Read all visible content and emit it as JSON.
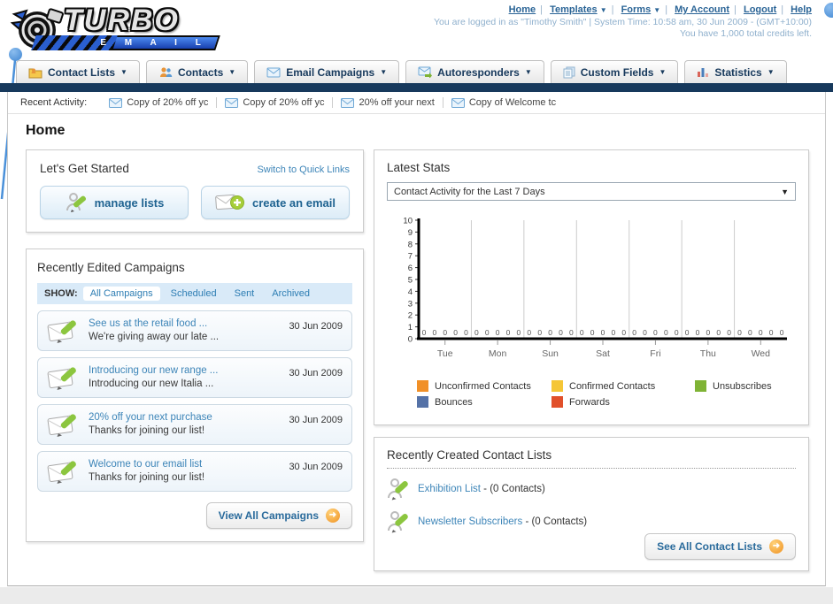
{
  "header": {
    "logo_title": "TURBO",
    "logo_subtitle": "E M A I L",
    "nav_links": [
      {
        "label": "Home"
      },
      {
        "label": "Templates"
      },
      {
        "label": "Forms"
      },
      {
        "label": "My Account"
      },
      {
        "label": "Logout"
      },
      {
        "label": "Help"
      }
    ],
    "status_line1": "You are logged in as \"Timothy Smith\" | System Time: 10:58 am, 30 Jun 2009 - (GMT+10:00)",
    "status_line2": "You have 1,000 total credits left."
  },
  "tabs": [
    {
      "label": "Contact Lists"
    },
    {
      "label": "Contacts"
    },
    {
      "label": "Email Campaigns"
    },
    {
      "label": "Autoresponders"
    },
    {
      "label": "Custom Fields"
    },
    {
      "label": "Statistics"
    }
  ],
  "recent_activity": {
    "label": "Recent Activity:",
    "items": [
      {
        "label": "Copy of 20% off yc"
      },
      {
        "label": "Copy of 20% off yc"
      },
      {
        "label": "20% off your next "
      },
      {
        "label": "Copy of Welcome tc"
      }
    ]
  },
  "page_title": "Home",
  "get_started": {
    "title": "Let's Get Started",
    "switch_link": "Switch to Quick Links",
    "manage_lists_label": "manage lists",
    "create_email_label": "create an email"
  },
  "campaigns": {
    "title": "Recently Edited Campaigns",
    "show_label": "SHOW:",
    "filters": [
      {
        "label": "All Campaigns",
        "active": true
      },
      {
        "label": "Scheduled",
        "active": false
      },
      {
        "label": "Sent",
        "active": false
      },
      {
        "label": "Archived",
        "active": false
      }
    ],
    "items": [
      {
        "title": "See us at the retail food ...",
        "subtitle": "We're giving away our late ...",
        "date": "30 Jun 2009"
      },
      {
        "title": "Introducing our new range ...",
        "subtitle": "Introducing our new Italia ...",
        "date": "30 Jun 2009"
      },
      {
        "title": "20% off your next purchase",
        "subtitle": "Thanks for joining our list!",
        "date": "30 Jun 2009"
      },
      {
        "title": "Welcome to our email list",
        "subtitle": "Thanks for joining our list!",
        "date": "30 Jun 2009"
      }
    ],
    "view_all_label": "View All Campaigns"
  },
  "stats": {
    "title": "Latest Stats",
    "dropdown_value": "Contact Activity for the Last 7 Days"
  },
  "chart_data": {
    "type": "bar",
    "title": "Contact Activity for the Last 7 Days",
    "categories": [
      "Tue",
      "Mon",
      "Sun",
      "Sat",
      "Fri",
      "Thu",
      "Wed"
    ],
    "series": [
      {
        "name": "Unconfirmed Contacts",
        "color": "#F19027",
        "values": [
          0,
          0,
          0,
          0,
          0,
          0,
          0
        ]
      },
      {
        "name": "Confirmed Contacts",
        "color": "#F5C636",
        "values": [
          0,
          0,
          0,
          0,
          0,
          0,
          0
        ]
      },
      {
        "name": "Unsubscribes",
        "color": "#7FB335",
        "values": [
          0,
          0,
          0,
          0,
          0,
          0,
          0
        ]
      },
      {
        "name": "Bounces",
        "color": "#5572A7",
        "values": [
          0,
          0,
          0,
          0,
          0,
          0,
          0
        ]
      },
      {
        "name": "Forwards",
        "color": "#E1502A",
        "values": [
          0,
          0,
          0,
          0,
          0,
          0,
          0
        ]
      }
    ],
    "xlabel": "",
    "ylabel": "",
    "ylim": [
      0,
      10
    ],
    "yticks": [
      0,
      1,
      2,
      3,
      4,
      5,
      6,
      7,
      8,
      9,
      10
    ],
    "grid": true,
    "legend_position": "bottom",
    "bar_labels_shown_as": "0 above axis for every series in every category"
  },
  "contact_lists": {
    "title": "Recently Created Contact Lists",
    "items": [
      {
        "name": "Exhibition List",
        "detail": "- (0 Contacts)"
      },
      {
        "name": "Newsletter Subscribers",
        "detail": "- (0 Contacts)"
      }
    ],
    "see_all_label": "See All Contact Lists"
  },
  "colors": {
    "navy_bar": "#17395c",
    "link_blue": "#3d85b8",
    "top_link_blue": "#2a6496",
    "status_text": "#8fb0cd",
    "show_bar_bg": "#d9eaf8",
    "orange_button_icon": "#ef9222"
  }
}
